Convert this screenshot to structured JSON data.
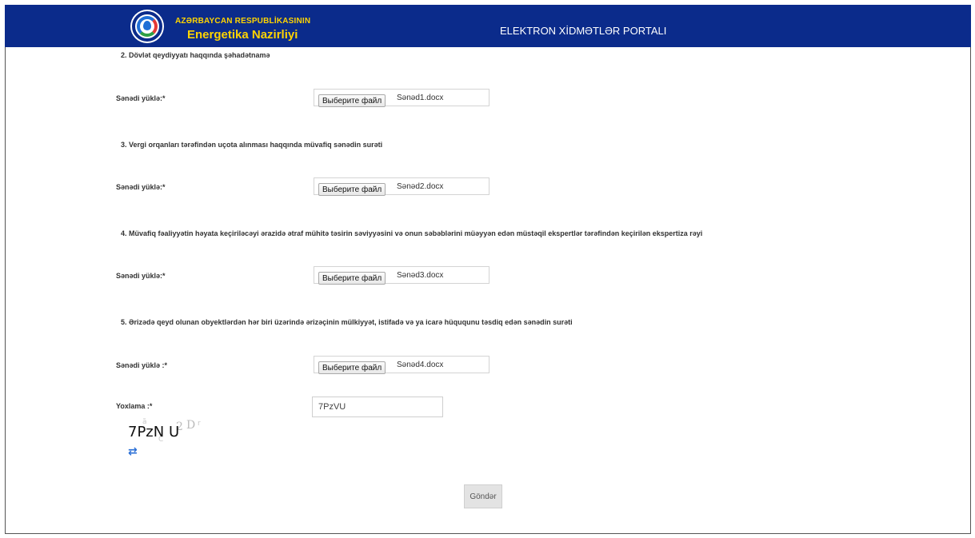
{
  "header": {
    "org_line1": "AZƏRBAYCAN RESPUBLİKASININ",
    "org_line2": "Energetika Nazirliyi",
    "portal_title": "ELEKTRON XİDMƏTLƏR PORTALI",
    "colors": {
      "background": "#0b2b8b",
      "org_text": "#ffd400",
      "portal_text": "#ffffff"
    }
  },
  "sections": [
    {
      "heading": "2. Dövlət qeydiyyatı haqqında şəhadətnamə",
      "label": "Sənədi yüklə:*",
      "button": "Выберите файл",
      "file": "Sənəd1.docx"
    },
    {
      "heading": "3. Vergi orqanları tərəfindən uçota alınması haqqında müvafiq sənədin surəti",
      "label": "Sənədi yüklə:*",
      "button": "Выберите файл",
      "file": "Sənəd2.docx"
    },
    {
      "heading": "4. Müvafiq fəaliyyətin həyata keçiriləcəyi ərazidə ətraf mühitə təsirin səviyyəsini və onun səbəblərini müəyyən edən müstəqil ekspertlər tərəfindən keçirilən ekspertiza rəyi",
      "label": "Sənədi yüklə:*",
      "button": "Выберите файл",
      "file": "Sənəd3.docx"
    },
    {
      "heading": "5. Ərizədə qeyd olunan obyektlərdən hər biri üzərində ərizəçinin mülkiyyət, istifadə və ya icarə hüququnu təsdiq edən sənədin surəti",
      "label": "Sənədi yüklə :*",
      "button": "Выберите файл",
      "file": "Sənəd4.docx"
    }
  ],
  "captcha": {
    "label": "Yoxlama :*",
    "input_value": "7PzVU",
    "image_text": "7PzN U"
  },
  "submit_label": "Göndər"
}
